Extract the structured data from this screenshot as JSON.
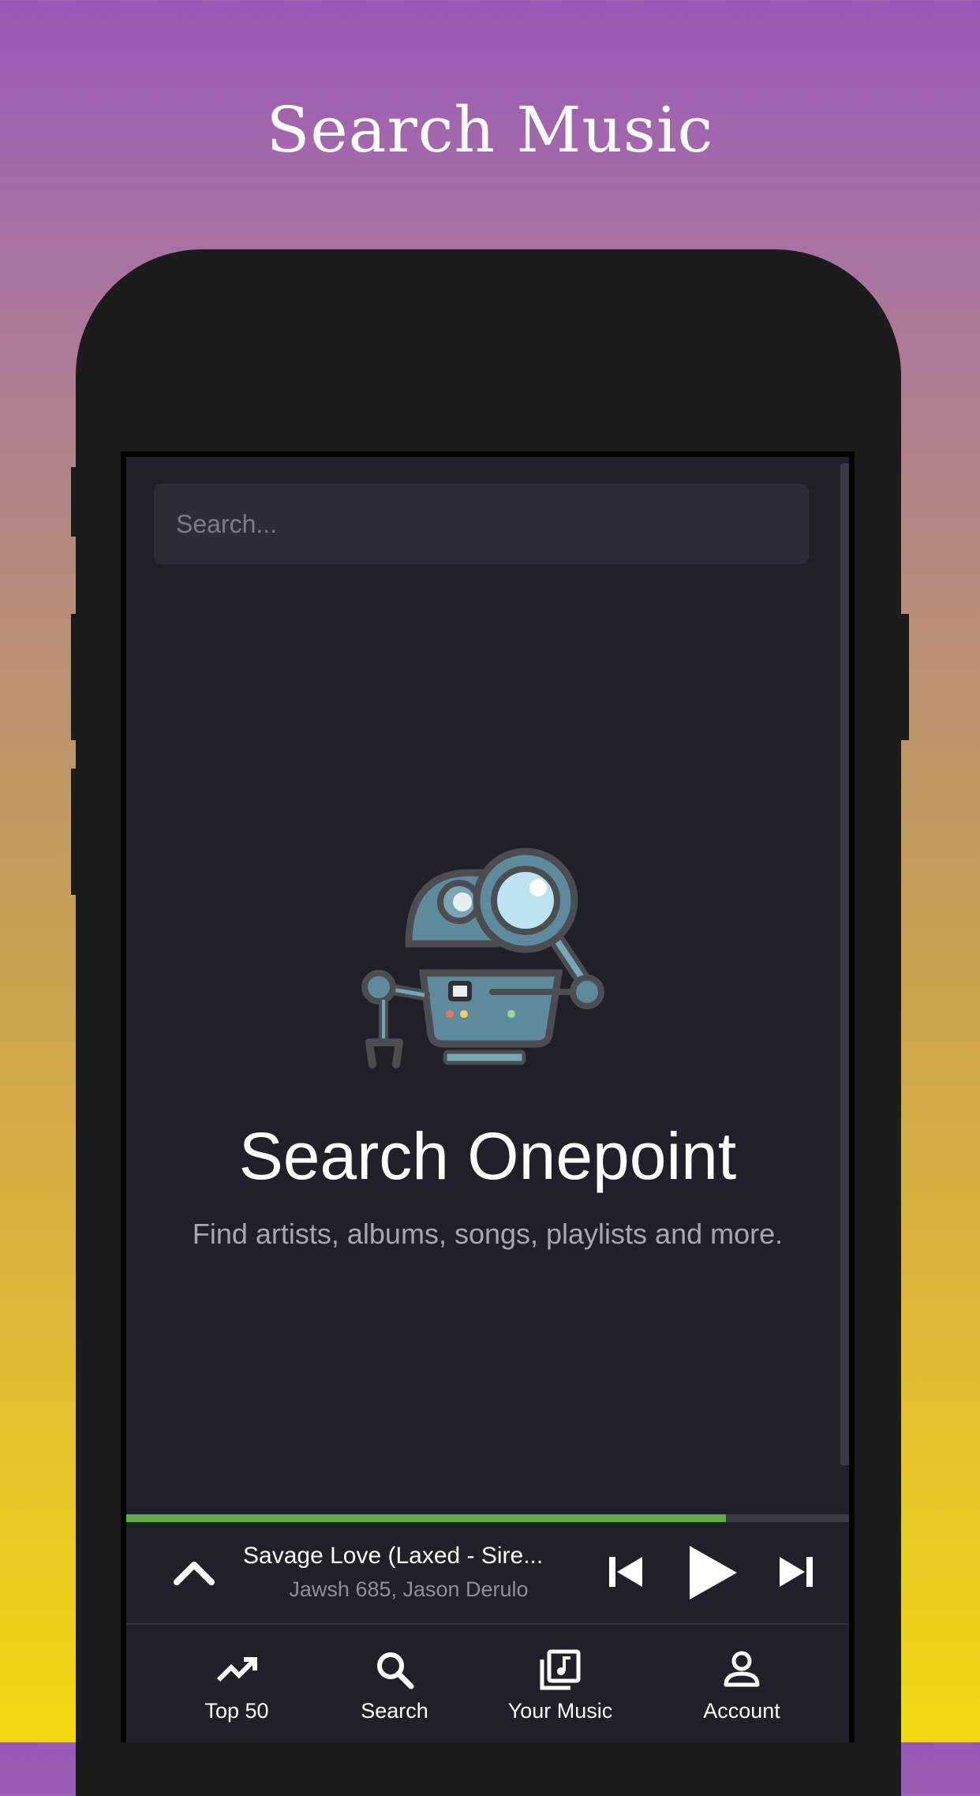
{
  "page": {
    "title": "Search Music"
  },
  "search": {
    "placeholder": "Search..."
  },
  "empty_state": {
    "title": "Search Onepoint",
    "subtitle": "Find artists, albums, songs, playlists and more."
  },
  "player": {
    "track_title": "Savage Love (Laxed - Sire...",
    "track_artist": "Jawsh 685, Jason Derulo",
    "progress": 0.83,
    "progress_color": "#62a843"
  },
  "nav": {
    "items": [
      {
        "label": "Top 50",
        "icon": "trending-up-icon"
      },
      {
        "label": "Search",
        "icon": "search-icon"
      },
      {
        "label": "Your Music",
        "icon": "library-music-icon"
      },
      {
        "label": "Account",
        "icon": "account-icon"
      }
    ]
  }
}
